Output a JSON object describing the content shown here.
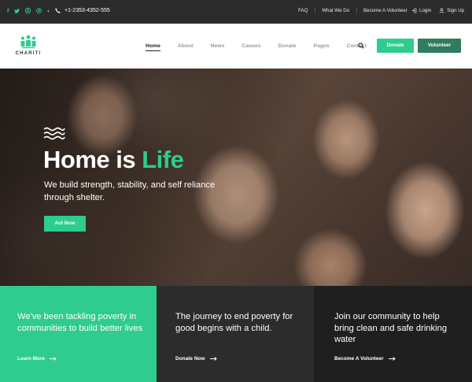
{
  "topbar": {
    "social_icons": [
      "facebook-icon",
      "twitter-icon",
      "instagram-icon",
      "pinterest-icon"
    ],
    "phone": "+1-2353-4352-555",
    "links": [
      "FAQ",
      "What We Do",
      "Become A Volunteer"
    ],
    "login": "Login",
    "signup": "Sign Up"
  },
  "header": {
    "logo_text": "CHARITI",
    "nav": [
      {
        "label": "Home",
        "active": true
      },
      {
        "label": "About"
      },
      {
        "label": "News"
      },
      {
        "label": "Causes"
      },
      {
        "label": "Donate"
      },
      {
        "label": "Pages"
      },
      {
        "label": "Contact"
      }
    ],
    "donate_label": "Donate",
    "volunteer_label": "Volunteer"
  },
  "hero": {
    "title_prefix": "Home is ",
    "title_accent": "Life",
    "subtitle": "We build strength, stability, and self reliance through shelter.",
    "cta_label": "Act Now"
  },
  "panels": [
    {
      "text": "We've been tackling poverty in communities to build better lives",
      "link": "Learn More"
    },
    {
      "text": "The journey to end poverty for good begins with a child.",
      "link": "Donate Now"
    },
    {
      "text": "Join our community to help bring clean and safe drinking water",
      "link": "Become A Volunteer"
    }
  ],
  "colors": {
    "accent": "#2ecc8f",
    "volunteer_button": "#2f7d5e",
    "topbar_bg": "#2b2b2b",
    "panel_dark": "#2c2c2c",
    "panel_darker": "#1f1f1f"
  }
}
